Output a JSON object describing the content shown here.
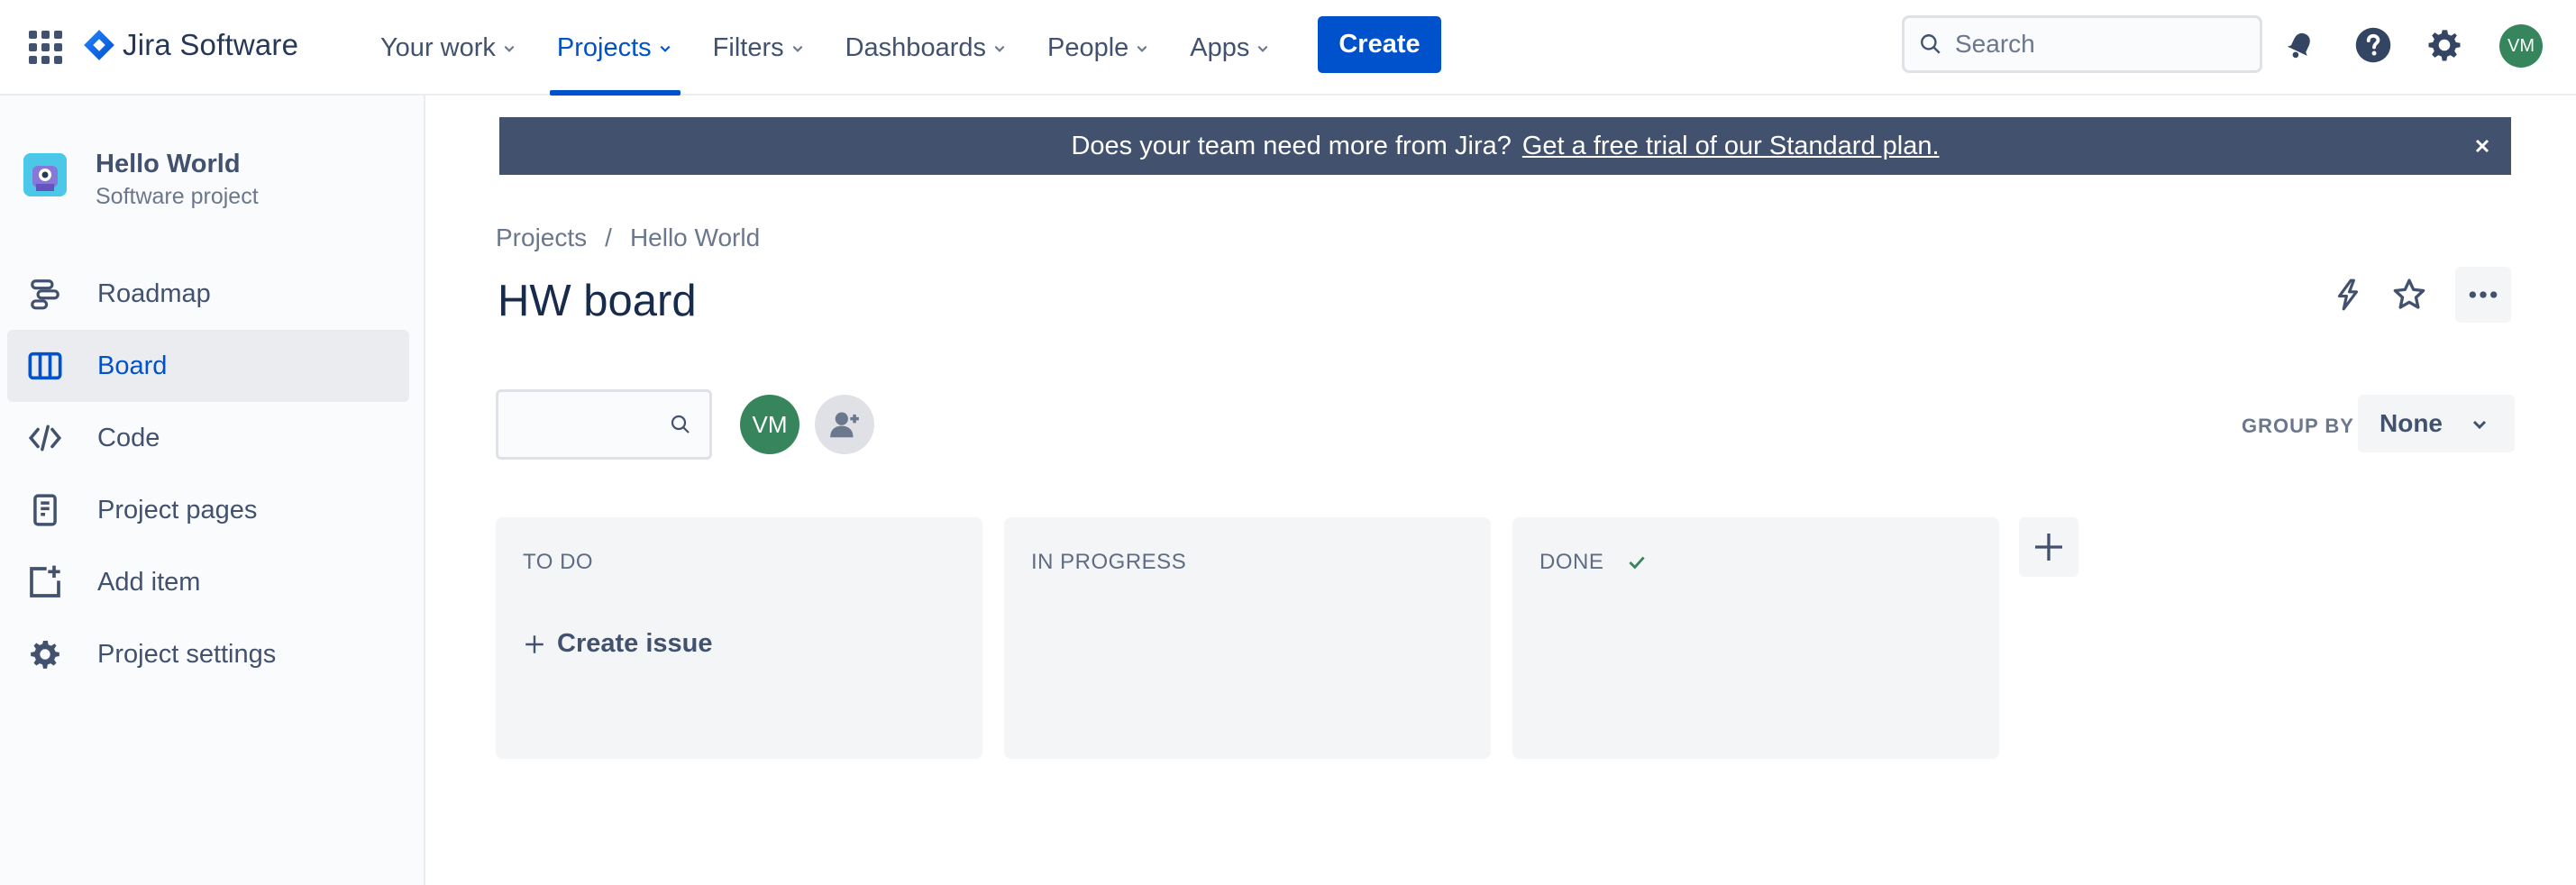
{
  "app": {
    "name": "Jira Software",
    "brand_color": "#0052cc"
  },
  "topnav": {
    "items": [
      {
        "label": "Your work",
        "active": false
      },
      {
        "label": "Projects",
        "active": true
      },
      {
        "label": "Filters",
        "active": false
      },
      {
        "label": "Dashboards",
        "active": false
      },
      {
        "label": "People",
        "active": false
      },
      {
        "label": "Apps",
        "active": false
      }
    ],
    "create_label": "Create",
    "search_placeholder": "Search",
    "user_initials": "VM",
    "icons": [
      "notifications-icon",
      "help-icon",
      "settings-icon"
    ]
  },
  "sidebar": {
    "project_name": "Hello World",
    "project_type": "Software project",
    "items": [
      {
        "label": "Roadmap",
        "icon": "roadmap-icon",
        "active": false
      },
      {
        "label": "Board",
        "icon": "board-icon",
        "active": true
      },
      {
        "label": "Code",
        "icon": "code-icon",
        "active": false
      },
      {
        "label": "Project pages",
        "icon": "pages-icon",
        "active": false
      },
      {
        "label": "Add item",
        "icon": "add-item-icon",
        "active": false
      },
      {
        "label": "Project settings",
        "icon": "settings-icon",
        "active": false
      }
    ]
  },
  "banner": {
    "text": "Does your team need more from Jira?",
    "link": "Get a free trial of our Standard plan."
  },
  "breadcrumb": [
    "Projects",
    "Hello World"
  ],
  "breadcrumb_separator": "/",
  "board": {
    "title": "HW board",
    "assignee_initials": "VM",
    "group_by_label": "GROUP BY",
    "group_by_value": "None",
    "columns": [
      {
        "title": "TO DO",
        "done_check": false,
        "create_issue": "Create issue"
      },
      {
        "title": "IN PROGRESS",
        "done_check": false
      },
      {
        "title": "DONE",
        "done_check": true
      }
    ]
  }
}
